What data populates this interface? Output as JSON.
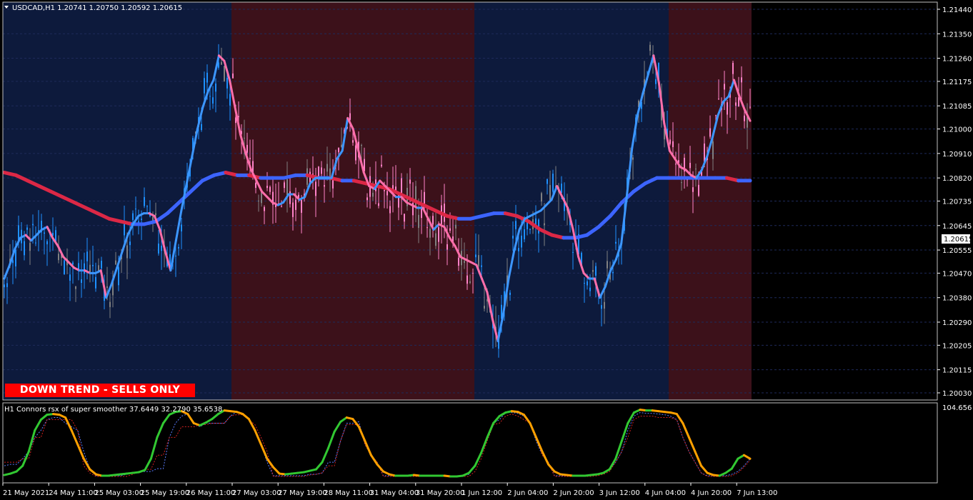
{
  "symbol_header": "USDCAD,H1  1.20741 1.20750 1.20592 1.20615",
  "indicator_header": "H1 Connors rsx of super smoother 37.6449 32.2790 35.6538",
  "trend_banner": "DOWN TREND - SELLS ONLY",
  "current_price": "1.20615",
  "colors": {
    "background": "#000000",
    "uptrend_zone": "#0d1a3c",
    "downtrend_zone": "#3c111a",
    "grid": "#1e2a5a",
    "bull_candle": "#1e90ff",
    "bear_candle": "#ff82c8",
    "neutral_candle": "#808080",
    "ma_up": "#3c64ff",
    "ma_down": "#dc2846",
    "fast_line_up": "#3c96ff",
    "fast_line_down": "#ff6eaa",
    "rsx_up": "#32c832",
    "rsx_down": "#ffa000",
    "banner": "#ff0000"
  },
  "chart_data": [
    {
      "type": "line",
      "title": "USDCAD,H1",
      "ylim": [
        1.2003,
        1.2144
      ],
      "y_ticks": [
        "1.21440",
        "1.21350",
        "1.21260",
        "1.21175",
        "1.21085",
        "1.21000",
        "1.20910",
        "1.20820",
        "1.20735",
        "1.20645",
        "1.20555",
        "1.20470",
        "1.20380",
        "1.20290",
        "1.20205",
        "1.20115",
        "1.20030"
      ],
      "x_ticks": [
        "21 May 2021",
        "24 May 11:00",
        "25 May 03:00",
        "25 May 19:00",
        "26 May 11:00",
        "27 May 03:00",
        "27 May 19:00",
        "28 May 11:00",
        "31 May 04:00",
        "31 May 20:00",
        "1 Jun 12:00",
        "2 Jun 04:00",
        "2 Jun 20:00",
        "3 Jun 12:00",
        "4 Jun 04:00",
        "4 Jun 20:00",
        "7 Jun 13:00"
      ],
      "trend_zones": [
        {
          "trend": "up",
          "start_bar": 0,
          "end_bar": 79
        },
        {
          "trend": "down",
          "start_bar": 80,
          "end_bar": 164
        },
        {
          "trend": "up",
          "start_bar": 165,
          "end_bar": 232
        },
        {
          "trend": "down",
          "start_bar": 233,
          "end_bar": 261
        }
      ],
      "series": [
        {
          "kind": "slow_ma",
          "values": [
            1.2084,
            1.2083,
            1.2081,
            1.2079,
            1.2077,
            1.2075,
            1.2073,
            1.2071,
            1.2069,
            1.2067,
            1.2066,
            1.2065,
            1.2065,
            1.2066,
            1.2069,
            1.2073,
            1.2077,
            1.2081,
            1.2083,
            1.2084,
            1.2083,
            1.2083,
            1.2082,
            1.2082,
            1.2082,
            1.2083,
            1.2083,
            1.2082,
            1.2082,
            1.2081,
            1.2081,
            1.208,
            1.2079,
            1.2078,
            1.2076,
            1.2074,
            1.2072,
            1.207,
            1.2068,
            1.2067,
            1.2067,
            1.2068,
            1.2069,
            1.2069,
            1.2068,
            1.2066,
            1.2063,
            1.2061,
            1.206,
            1.206,
            1.2061,
            1.2064,
            1.2068,
            1.2073,
            1.2077,
            1.208,
            1.2082,
            1.2082,
            1.2082,
            1.2082,
            1.2082,
            1.2082,
            1.2082,
            1.2081,
            1.2081
          ]
        },
        {
          "kind": "fast_line",
          "values": [
            1.2045,
            1.205,
            1.2056,
            1.206,
            1.2061,
            1.2059,
            1.2061,
            1.2063,
            1.2064,
            1.206,
            1.2057,
            1.2053,
            1.2051,
            1.2049,
            1.2048,
            1.2048,
            1.2047,
            1.2047,
            1.2048,
            1.2038,
            1.2043,
            1.2049,
            1.2055,
            1.2061,
            1.2065,
            1.2068,
            1.2069,
            1.2069,
            1.2068,
            1.2063,
            1.2055,
            1.2048,
            1.2059,
            1.207,
            1.208,
            1.209,
            1.21,
            1.2108,
            1.2114,
            1.2118,
            1.2127,
            1.2125,
            1.2118,
            1.2108,
            1.2098,
            1.2091,
            1.2085,
            1.2081,
            1.2077,
            1.2075,
            1.2073,
            1.2072,
            1.2073,
            1.2076,
            1.2076,
            1.2074,
            1.2075,
            1.208,
            1.2082,
            1.2082,
            1.2082,
            1.2082,
            1.2089,
            1.2092,
            1.2104,
            1.21,
            1.2092,
            1.2084,
            1.2079,
            1.2078,
            1.2081,
            1.2079,
            1.2077,
            1.2075,
            1.2075,
            1.2073,
            1.2072,
            1.2071,
            1.2071,
            1.2067,
            1.2063,
            1.2065,
            1.2064,
            1.206,
            1.2057,
            1.2053,
            1.2052,
            1.2051,
            1.205,
            1.2045,
            1.204,
            1.203,
            1.2022,
            1.2032,
            1.2045,
            1.2055,
            1.2063,
            1.2067,
            1.2068,
            1.2069,
            1.207,
            1.2072,
            1.2074,
            1.2079,
            1.2075,
            1.2071,
            1.2063,
            1.2053,
            1.2047,
            1.2045,
            1.2045,
            1.2038,
            1.2042,
            1.2048,
            1.2052,
            1.2058,
            1.2075,
            1.2093,
            1.2105,
            1.2113,
            1.212,
            1.2127,
            1.2117,
            1.2102,
            1.2092,
            1.2089,
            1.2086,
            1.2085,
            1.2083,
            1.2082,
            1.2085,
            1.209,
            1.2097,
            1.2105,
            1.211,
            1.2112,
            1.2118,
            1.2112,
            1.2107,
            1.2103
          ]
        },
        {
          "kind": "rsx",
          "panel_ylim": [
            0,
            104.656
          ],
          "values": [
            7,
            9,
            12,
            20,
            40,
            70,
            85,
            92,
            93,
            92,
            88,
            70,
            50,
            30,
            15,
            8,
            6,
            6,
            7,
            8,
            9,
            10,
            11,
            14,
            30,
            60,
            80,
            92,
            96,
            97,
            93,
            80,
            77,
            81,
            86,
            93,
            98,
            97,
            96,
            93,
            86,
            70,
            50,
            30,
            18,
            9,
            8,
            9,
            10,
            11,
            13,
            15,
            25,
            45,
            68,
            82,
            88,
            86,
            75,
            55,
            35,
            22,
            12,
            8,
            6,
            6,
            6,
            7,
            6,
            6,
            6,
            6,
            6,
            5,
            5,
            6,
            10,
            20,
            38,
            60,
            80,
            90,
            95,
            97,
            96,
            92,
            80,
            60,
            40,
            22,
            12,
            8,
            7,
            6,
            6,
            6,
            7,
            8,
            10,
            15,
            30,
            55,
            80,
            95,
            99,
            98,
            98,
            97,
            96,
            95,
            93,
            80,
            60,
            40,
            20,
            10,
            7,
            6,
            10,
            16,
            30,
            35,
            30
          ]
        },
        {
          "kind": "signal_dashed",
          "values": [
            20,
            22,
            22,
            30,
            40,
            60,
            70,
            85,
            88,
            88,
            80,
            75,
            70,
            40,
            15,
            6,
            6,
            6,
            6,
            6,
            8,
            10,
            12,
            12,
            12,
            16,
            16,
            60,
            80,
            90,
            93,
            80,
            75,
            80,
            80,
            80,
            80,
            90,
            96,
            94,
            85,
            70,
            50,
            25,
            6,
            6,
            6,
            6,
            6,
            6,
            8,
            8,
            10,
            25,
            25,
            55,
            80,
            80,
            82,
            50,
            35,
            25,
            6,
            6,
            6,
            6,
            6,
            6,
            6,
            6,
            6,
            6,
            6,
            6,
            6,
            6,
            8,
            20,
            40,
            60,
            80,
            85,
            95,
            95,
            94,
            90,
            80,
            55,
            35,
            25,
            6,
            6,
            6,
            6,
            6,
            6,
            6,
            8,
            10,
            15,
            25,
            40,
            70,
            90,
            95,
            94,
            94,
            93,
            92,
            90,
            85,
            60,
            40,
            25,
            10,
            6,
            6,
            6,
            6,
            8,
            12,
            20,
            30
          ]
        },
        {
          "kind": "trigger_dashed",
          "values": [
            25,
            25,
            25,
            30,
            30,
            60,
            60,
            85,
            85,
            85,
            85,
            85,
            70,
            20,
            10,
            5,
            5,
            5,
            5,
            5,
            5,
            8,
            12,
            15,
            15,
            35,
            35,
            60,
            60,
            75,
            75,
            75,
            78,
            78,
            80,
            80,
            80,
            90,
            92,
            92,
            85,
            78,
            60,
            40,
            5,
            5,
            5,
            5,
            5,
            5,
            7,
            8,
            10,
            20,
            20,
            55,
            78,
            78,
            78,
            50,
            35,
            25,
            5,
            5,
            5,
            5,
            5,
            5,
            5,
            5,
            5,
            5,
            5,
            5,
            5,
            5,
            5,
            12,
            30,
            55,
            78,
            80,
            90,
            93,
            90,
            85,
            80,
            60,
            35,
            25,
            5,
            5,
            5,
            5,
            5,
            5,
            5,
            6,
            8,
            12,
            25,
            40,
            60,
            85,
            90,
            90,
            90,
            88,
            88,
            88,
            85,
            60,
            40,
            25,
            10,
            5,
            5,
            5,
            5,
            6,
            10,
            18,
            28
          ]
        }
      ]
    }
  ]
}
